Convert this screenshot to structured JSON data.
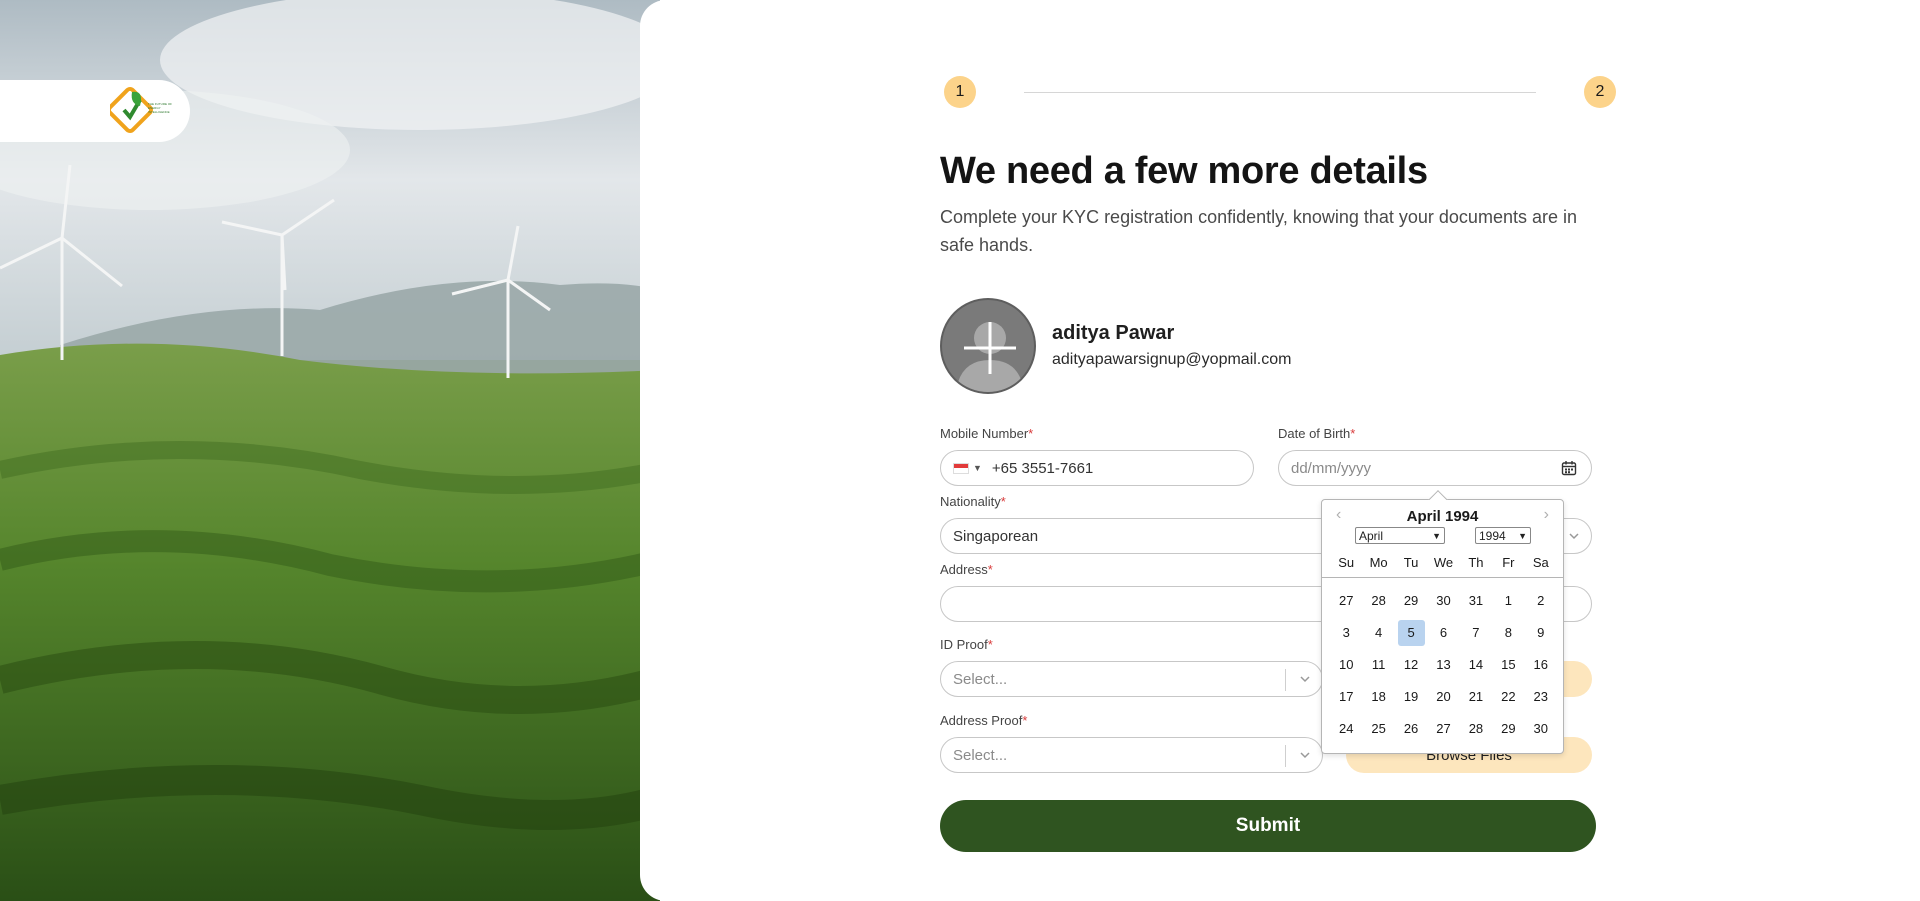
{
  "brand": {
    "logo_icon": "leaf-check-logo",
    "logo_text": "THE FUTURE OF ENERGY INTELLIGENCE"
  },
  "stepper": {
    "steps": [
      {
        "number": "1"
      },
      {
        "number": "2"
      }
    ]
  },
  "header": {
    "title": "We need a few more details",
    "subtitle": "Complete your KYC registration confidently, knowing that your documents are in safe hands."
  },
  "profile": {
    "avatar_icon": "add-photo-icon",
    "name": "aditya Pawar",
    "email": "adityapawarsignup@yopmail.com"
  },
  "form": {
    "mobile": {
      "label": "Mobile Number",
      "required_mark": "*",
      "value": "+65 3551-7661",
      "country_flag": "singapore-flag-icon"
    },
    "dob": {
      "label": "Date of Birth",
      "required_mark": "*",
      "placeholder": "dd/mm/yyyy",
      "icon": "calendar-icon"
    },
    "nationality": {
      "label": "Nationality",
      "required_mark": "*",
      "value": "Singaporean"
    },
    "address": {
      "label": "Address",
      "required_mark": "*",
      "value": ""
    },
    "id_proof": {
      "label": "ID Proof",
      "required_mark": "*",
      "placeholder": "Select..."
    },
    "address_proof": {
      "label": "Address Proof",
      "required_mark": "*",
      "placeholder": "Select...",
      "browse_label": "Browse Files"
    },
    "submit_label": "Submit"
  },
  "datepicker": {
    "title": "April 1994",
    "month_select": "April",
    "year_select": "1994",
    "weekdays": [
      "Su",
      "Mo",
      "Tu",
      "We",
      "Th",
      "Fr",
      "Sa"
    ],
    "days": [
      "27",
      "28",
      "29",
      "30",
      "31",
      "1",
      "2",
      "3",
      "4",
      "5",
      "6",
      "7",
      "8",
      "9",
      "10",
      "11",
      "12",
      "13",
      "14",
      "15",
      "16",
      "17",
      "18",
      "19",
      "20",
      "21",
      "22",
      "23",
      "24",
      "25",
      "26",
      "27",
      "28",
      "29",
      "30"
    ],
    "selected_day": "5"
  },
  "colors": {
    "accent_green": "#2f5420",
    "step_yellow": "#fcd38a",
    "browse_bg": "#fde6bd",
    "selected_day": "#b9d3ef",
    "required": "#d83a3a"
  }
}
